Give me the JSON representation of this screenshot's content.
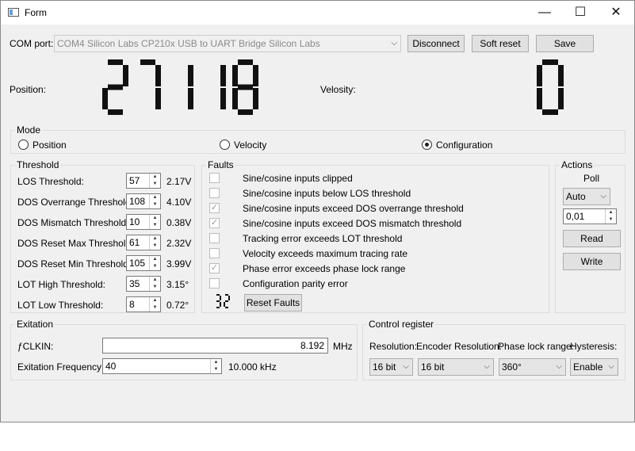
{
  "window": {
    "title": "Form",
    "minimize_glyph": "—",
    "maximize_glyph": "☐",
    "close_glyph": "✕"
  },
  "com": {
    "label": "COM port:",
    "selected": "COM4 Silicon Labs CP210x USB to UART Bridge Silicon Labs",
    "disconnect": "Disconnect",
    "soft_reset": "Soft reset",
    "save": "Save"
  },
  "readouts": {
    "position_label": "Position:",
    "position_value": "27118",
    "velocity_label": "Velosity:",
    "velocity_value": "0"
  },
  "mode": {
    "title": "Mode",
    "options": [
      "Position",
      "Velocity",
      "Configuration"
    ],
    "selected": "Configuration"
  },
  "threshold": {
    "title": "Threshold",
    "rows": [
      {
        "label": "LOS Threshold:",
        "value": "57",
        "unit": "2.17V"
      },
      {
        "label": "DOS Overrange Threshold:",
        "value": "108",
        "unit": "4.10V"
      },
      {
        "label": "DOS Mismatch Threshold:",
        "value": "10",
        "unit": "0.38V"
      },
      {
        "label": "DOS Reset Max Threshold:",
        "value": "61",
        "unit": "2.32V"
      },
      {
        "label": "DOS Reset Min Threshold:",
        "value": "105",
        "unit": "3.99V"
      },
      {
        "label": "LOT High Threshold:",
        "value": "35",
        "unit": "3.15°"
      },
      {
        "label": "LOT Low Threshold:",
        "value": "8",
        "unit": "0.72°"
      }
    ]
  },
  "faults": {
    "title": "Faults",
    "items": [
      {
        "label": "Sine/cosine inputs clipped",
        "checked": false
      },
      {
        "label": "Sine/cosine inputs below LOS threshold",
        "checked": false
      },
      {
        "label": "Sine/cosine inputs exceed DOS overrange threshold",
        "checked": true
      },
      {
        "label": "Sine/cosine inputs exceed DOS mismatch threshold",
        "checked": true
      },
      {
        "label": "Tracking error exceeds LOT threshold",
        "checked": false
      },
      {
        "label": "Velocity exceeds maximum tracing rate",
        "checked": false
      },
      {
        "label": "Phase error exceeds phase lock range",
        "checked": true
      },
      {
        "label": "Configuration parity error",
        "checked": false
      }
    ],
    "counter": "32",
    "reset_button": "Reset Faults"
  },
  "actions": {
    "title": "Actions",
    "poll_label": "Poll",
    "poll_mode": "Auto",
    "poll_interval": "0,01",
    "read": "Read",
    "write": "Write"
  },
  "excitation": {
    "title": "Exitation",
    "fclkin_label": "ƒCLKIN:",
    "fclkin_value": "8.192",
    "fclkin_unit": "MHz",
    "freq_label": "Exitation Frequency:",
    "freq_value": "40",
    "freq_display": "10.000 kHz"
  },
  "control": {
    "title": "Control register",
    "labels": [
      "Resolution:",
      "Encoder Resolution:",
      "Phase lock range:",
      "Hysteresis:"
    ],
    "values": [
      "16 bit",
      "16 bit",
      "360°",
      "Enable"
    ]
  },
  "icons": {
    "spin_up": "▲",
    "spin_down": "▼",
    "combo_arrow": "⌵",
    "check_mark": "✓"
  }
}
